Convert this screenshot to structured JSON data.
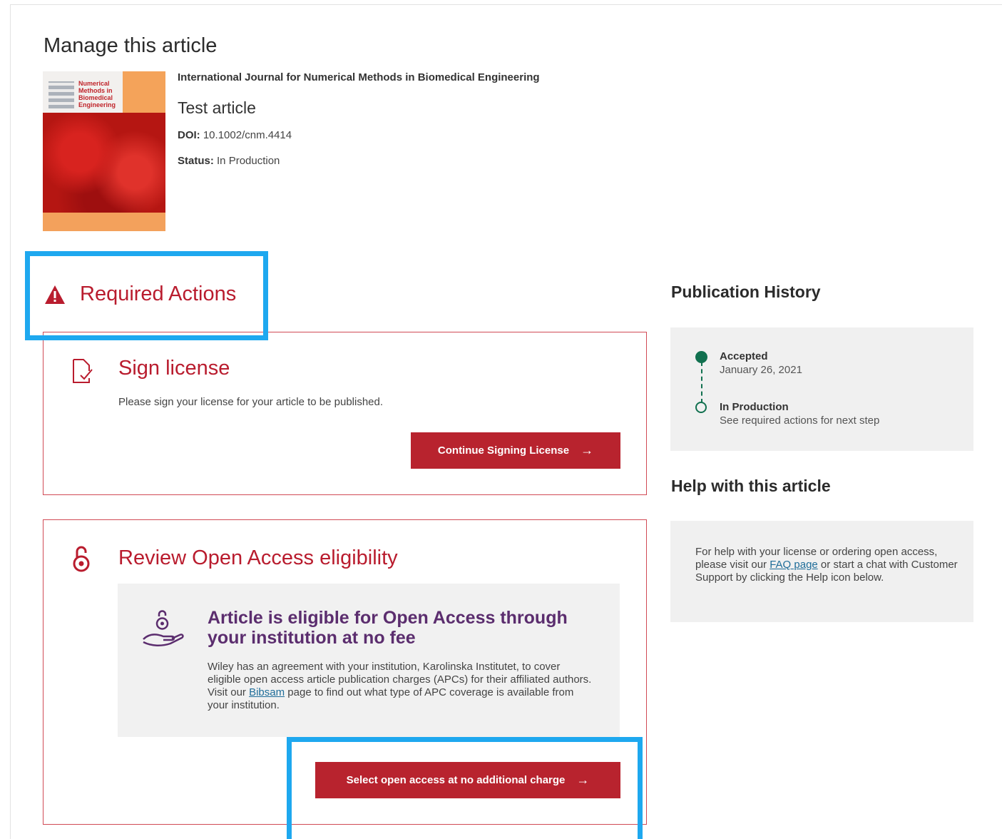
{
  "page": {
    "title": "Manage this article"
  },
  "article": {
    "journal": "International Journal for Numerical Methods in Biomedical Engineering",
    "title": "Test article",
    "doi_label": "DOI:",
    "doi_value": "10.1002/cnm.4414",
    "status_label": "Status:",
    "status_value": "In Production",
    "cover_title": "Numerical Methods in Biomedical Engineering"
  },
  "required_actions": {
    "heading": "Required Actions",
    "sign_license": {
      "title": "Sign license",
      "description": "Please sign your license for your article to be published.",
      "button_label": "Continue Signing License"
    },
    "open_access": {
      "title": "Review Open Access eligibility",
      "eligibility_title": "Article is eligible for Open Access through your institution at no fee",
      "desc_before_link": "Wiley has an agreement with your institution, Karolinska Institutet, to cover eligible open access article publication charges (APCs) for their affiliated authors. Visit our ",
      "link_text": "Bibsam",
      "desc_after_link": " page to find out what type of APC coverage is available from your institution.",
      "button_label": "Select open access at no additional charge"
    }
  },
  "publication_history": {
    "heading": "Publication History",
    "items": [
      {
        "label": "Accepted",
        "sub": "January 26, 2021"
      },
      {
        "label": "In Production",
        "sub": "See required actions for next step"
      }
    ]
  },
  "help": {
    "heading": "Help with this article",
    "text_before_link": "For help with your license or ordering open access, please visit our ",
    "link_text": "FAQ page",
    "text_after_link": " or start a chat with Customer Support by clicking the Help icon below."
  },
  "colors": {
    "accent_red": "#b91c2e",
    "button_red": "#b8232e",
    "purple": "#5b2d6e",
    "green": "#11704f",
    "highlight_blue": "#1ea8ef"
  },
  "icons": {
    "warning": "warning-triangle-icon",
    "license": "document-check-icon",
    "open_access": "open-access-lock-icon",
    "oa_hand": "hand-open-access-icon",
    "arrow": "arrow-right-icon"
  }
}
